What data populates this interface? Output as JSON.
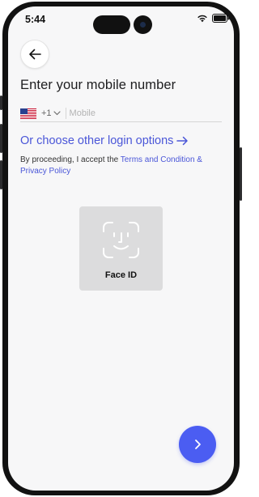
{
  "status_bar": {
    "time": "5:44"
  },
  "header": {
    "title": "Enter your mobile number"
  },
  "phone_input": {
    "country_code": "+1",
    "placeholder": "Mobile",
    "value": ""
  },
  "links": {
    "other_login": "Or choose other login options"
  },
  "consent": {
    "prefix": "By proceeding, I accept the ",
    "terms_link": "Terms and Condition & Privacy Policy"
  },
  "faceid": {
    "label": "Face ID"
  },
  "colors": {
    "accent": "#4b5df2",
    "link": "#4a56d8",
    "background": "#f7f7f8"
  },
  "icons": [
    "back-arrow-icon",
    "us-flag-icon",
    "chevron-down-icon",
    "arrow-right-icon",
    "face-id-icon",
    "chevron-right-icon",
    "wifi-icon",
    "battery-icon",
    "signal-icon"
  ]
}
